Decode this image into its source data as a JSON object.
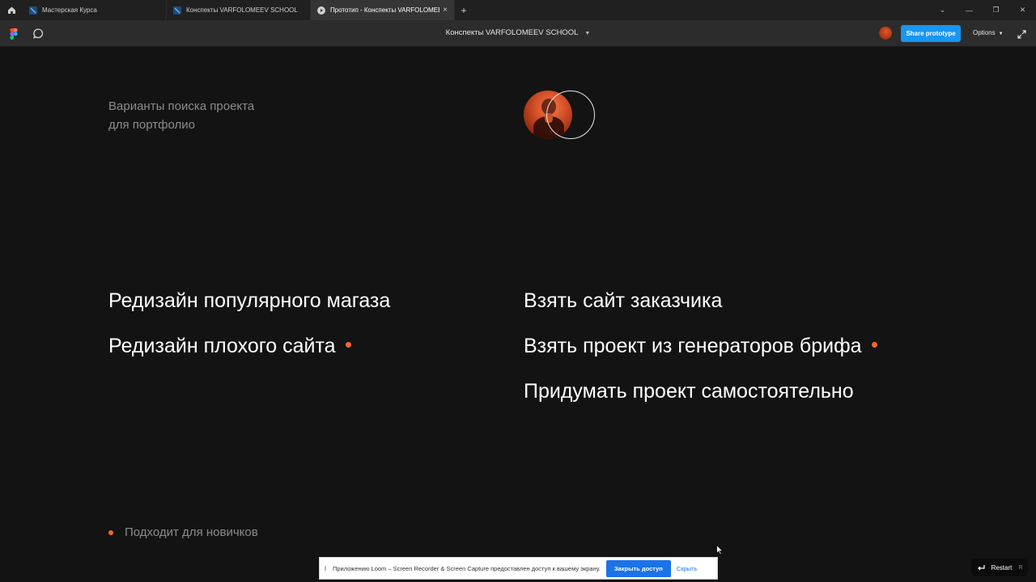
{
  "browser": {
    "tabs": [
      {
        "title": "Мастерская Курса",
        "active": false,
        "icon": "figma-file-icon"
      },
      {
        "title": "Конспекты VARFOLOMEEV SCHOOL",
        "active": false,
        "icon": "figma-file-icon"
      },
      {
        "title": "Прототип - Конспекты VARFOLOMEEV SCHOOL",
        "active": true,
        "icon": "play-icon"
      }
    ],
    "new_tab_label": "+",
    "tab_close_glyph": "×"
  },
  "toolbar": {
    "doc_title": "Конспекты VARFOLOMEEV SCHOOL",
    "share_label": "Share prototype",
    "options_label": "Options"
  },
  "slide": {
    "subtitle_line1": "Варианты поиска проекта",
    "subtitle_line2": "для портфолио",
    "left_items": [
      {
        "text": "Редизайн популярного магаза",
        "marked": false
      },
      {
        "text": "Редизайн плохого сайта",
        "marked": true
      }
    ],
    "right_items": [
      {
        "text": "Взять сайт заказчика",
        "marked": false
      },
      {
        "text": "Взять проект из генераторов брифа",
        "marked": true
      },
      {
        "text": "Придумать проект самостоятельно",
        "marked": false
      }
    ],
    "legend": "Подходит для новичков",
    "accent_color": "#f2692c"
  },
  "notification": {
    "message": "Приложению Loom – Screen Recorder & Screen Capture предоставлен доступ к вашему экрану.",
    "stop_label": "Закрыть доступ",
    "hide_label": "Скрыть"
  },
  "restart": {
    "label": "Restart",
    "shortcut": "R"
  }
}
